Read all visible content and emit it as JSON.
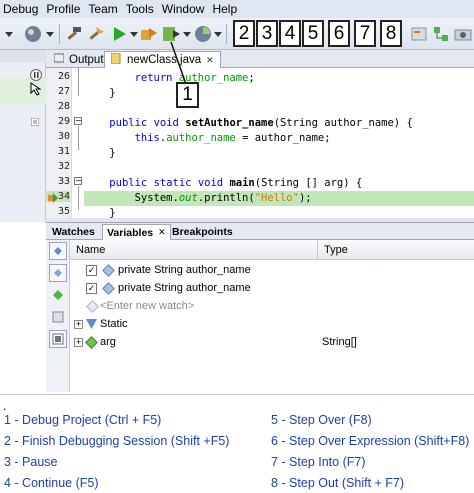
{
  "menu": [
    "Debug",
    "Profile",
    "Team",
    "Tools",
    "Window",
    "Help"
  ],
  "callouts": [
    "1",
    "2",
    "3",
    "4",
    "5",
    "6",
    "7",
    "8"
  ],
  "editor_tabs": [
    {
      "label": "Output"
    },
    {
      "label": "newClass.java"
    }
  ],
  "code_lines": [
    {
      "num": "26",
      "text": "        return author_name;"
    },
    {
      "num": "27",
      "text": "    }"
    },
    {
      "num": "28",
      "text": ""
    },
    {
      "num": "29",
      "text": "    public void setAuthor_name(String author_name) {"
    },
    {
      "num": "30",
      "text": "        this.author_name = author_name;"
    },
    {
      "num": "31",
      "text": "    }"
    },
    {
      "num": "32",
      "text": ""
    },
    {
      "num": "33",
      "text": "    public static void main(String [] arg) {"
    },
    {
      "num": "34",
      "text": "        System.out.println(\"Hello\");"
    },
    {
      "num": "35",
      "text": "    }"
    }
  ],
  "debug_tabs": [
    "Watches",
    "Variables",
    "Breakpoints"
  ],
  "variables": {
    "col_name": "Name",
    "col_type": "Type",
    "rows": [
      {
        "name": "private String author_name",
        "type": ""
      },
      {
        "name": "private String author_name",
        "type": ""
      },
      {
        "name": "<Enter new watch>",
        "type": ""
      },
      {
        "name": "Static",
        "type": ""
      },
      {
        "name": "arg",
        "type": "String[]"
      }
    ]
  },
  "legend": {
    "dot": ".",
    "left": [
      "1 -  Debug Project (Ctrl + F5)",
      "2 -  Finish Debugging Session (Shift +F5)",
      "3 -  Pause",
      "4 -  Continue (F5)"
    ],
    "right": [
      "5  -  Step Over (F8)",
      "6 - Step Over Expression (Shift+F8)",
      "7 - Step Into (F7)",
      "8 - Step Out (Shift + F7)"
    ]
  },
  "colors": {
    "highlight_line": "#c2e6b7",
    "keyword": "#0000e6",
    "field": "#009900",
    "string": "#ce7b00",
    "legend_text": "#1f3fa8"
  }
}
